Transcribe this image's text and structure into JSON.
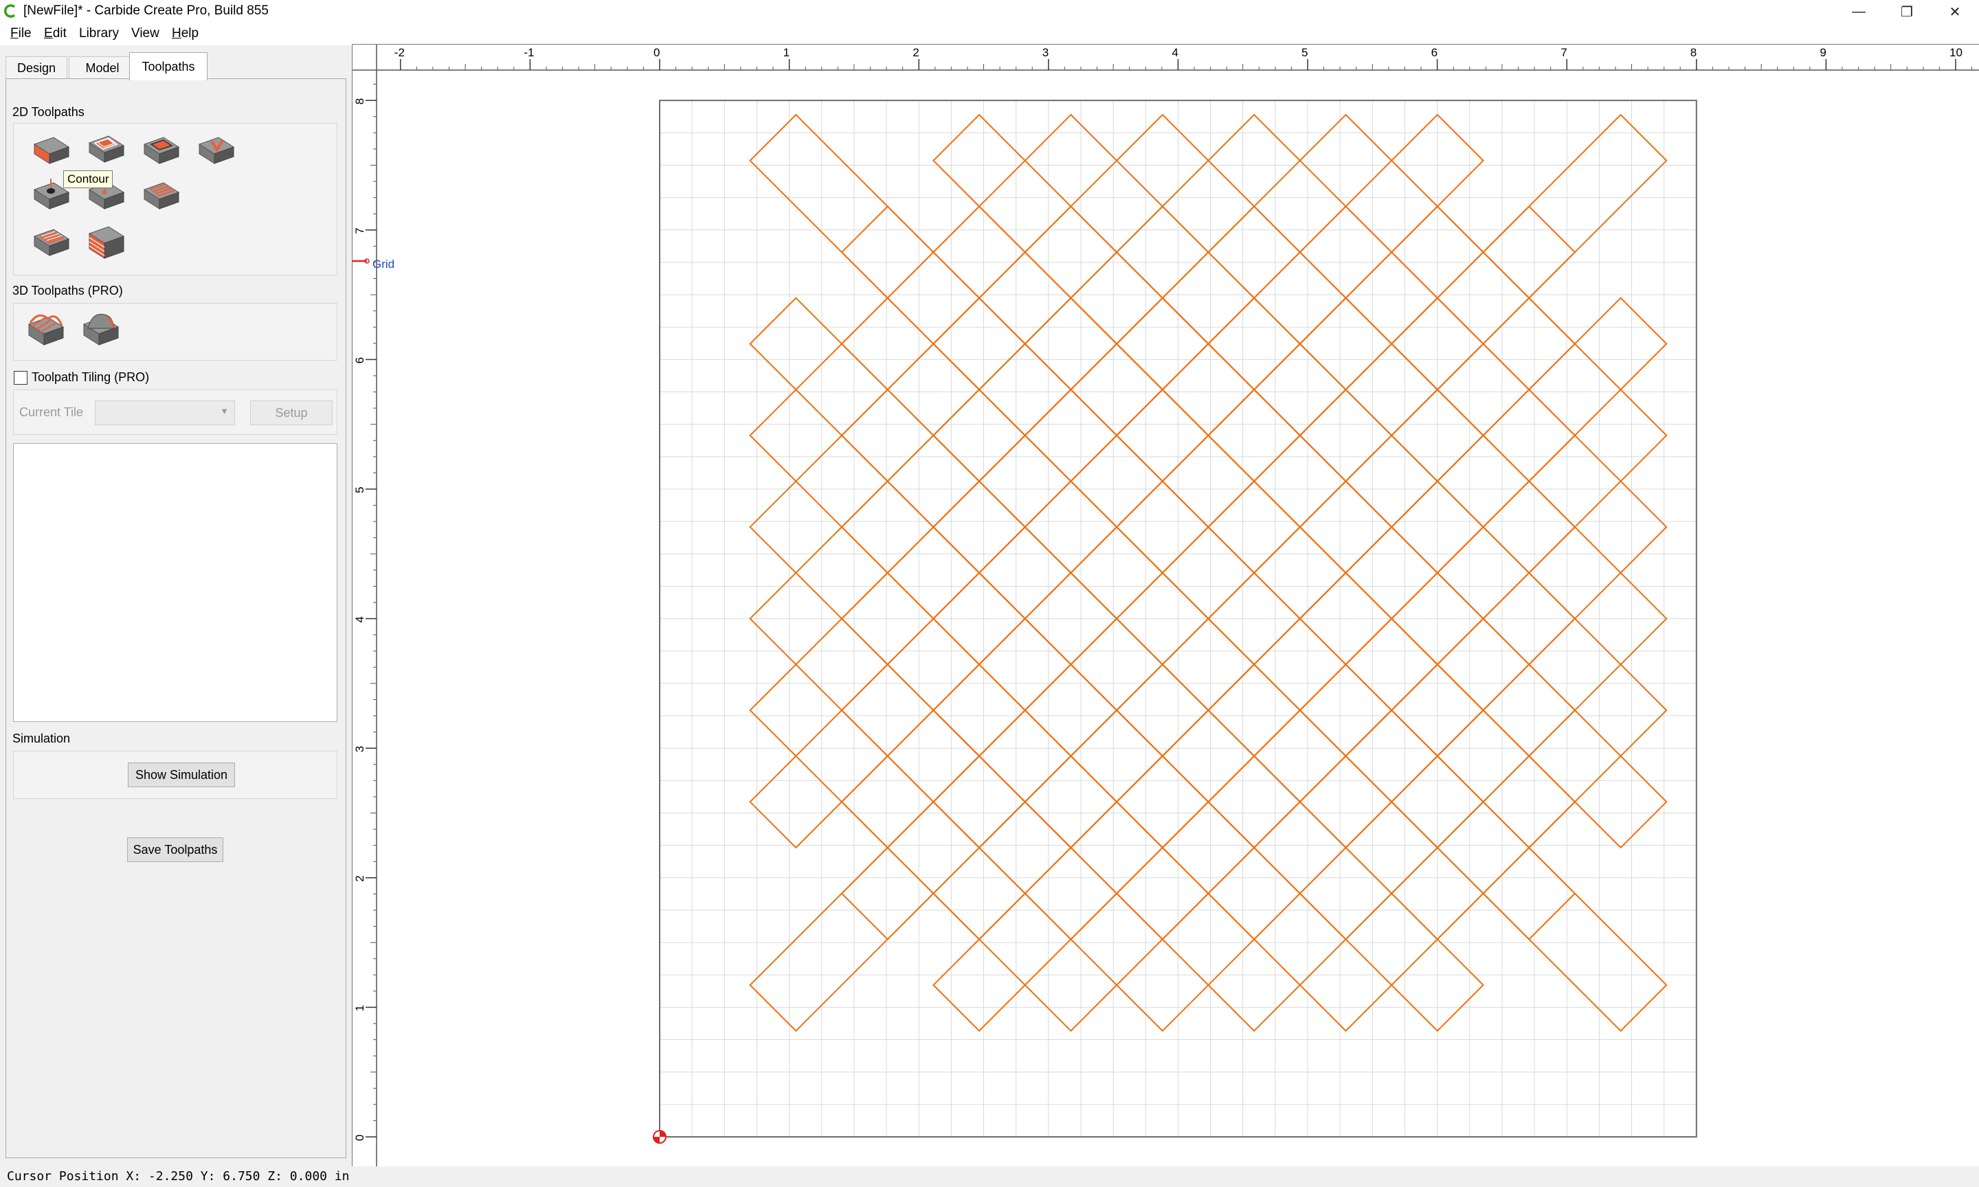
{
  "window": {
    "title": "[NewFile]* - Carbide Create Pro, Build 855",
    "controls": [
      "—",
      "❐",
      "✕"
    ],
    "accent_color": "#3a9d23"
  },
  "menu": [
    {
      "label": "File",
      "underline": "F",
      "rest": "ile"
    },
    {
      "label": "Edit",
      "underline": "E",
      "rest": "dit"
    },
    {
      "label": "Library",
      "underline": "",
      "rest": "Library"
    },
    {
      "label": "View",
      "underline": "",
      "rest": "View"
    },
    {
      "label": "Help",
      "underline": "H",
      "rest": "elp"
    }
  ],
  "tabs": [
    {
      "label": "Design",
      "active": false
    },
    {
      "label": "Model",
      "active": false
    },
    {
      "label": "Toolpaths",
      "active": true
    }
  ],
  "toolpaths_2d": {
    "label": "2D Toolpaths",
    "icons": [
      "contour-toolpath-icon",
      "pocket-toolpath-icon",
      "advanced-vcarve-icon",
      "vcarve-toolpath-icon",
      "drill-toolpath-icon",
      "single-cutter-icon",
      "texture-toolpath-icon",
      "flatten-toolpath-icon",
      "adaptive-toolpath-icon"
    ],
    "tooltip": "Contour"
  },
  "toolpaths_3d": {
    "label": "3D Toolpaths (PRO)",
    "icons": [
      "3d-rough-icon",
      "3d-finish-icon"
    ]
  },
  "tiling": {
    "label": "Toolpath Tiling (PRO)",
    "checked": false,
    "current_tile_label": "Current Tile",
    "current_tile_value": "",
    "setup_label": "Setup"
  },
  "simulation": {
    "label": "Simulation",
    "show_button": "Show Simulation"
  },
  "save_button": "Save Toolpaths",
  "status": {
    "cursor_text": "Cursor Position X: -2.250 Y: 6.750 Z: 0.000 in"
  },
  "canvas": {
    "grid_label": "Grid",
    "x_ruler": [
      "-2",
      "-1",
      "0",
      "1",
      "2",
      "3",
      "4",
      "5",
      "6",
      "7",
      "8",
      "9",
      "10"
    ],
    "y_ruler": [
      "0",
      "1",
      "2",
      "3",
      "4",
      "5",
      "6",
      "7",
      "8"
    ],
    "stock_width_in": 8,
    "stock_height_in": 8,
    "grid_spacing_in": 0.25,
    "pattern_color": "#f07010",
    "grid_color": "#d9d9d9",
    "origin_color": "#e02020"
  }
}
